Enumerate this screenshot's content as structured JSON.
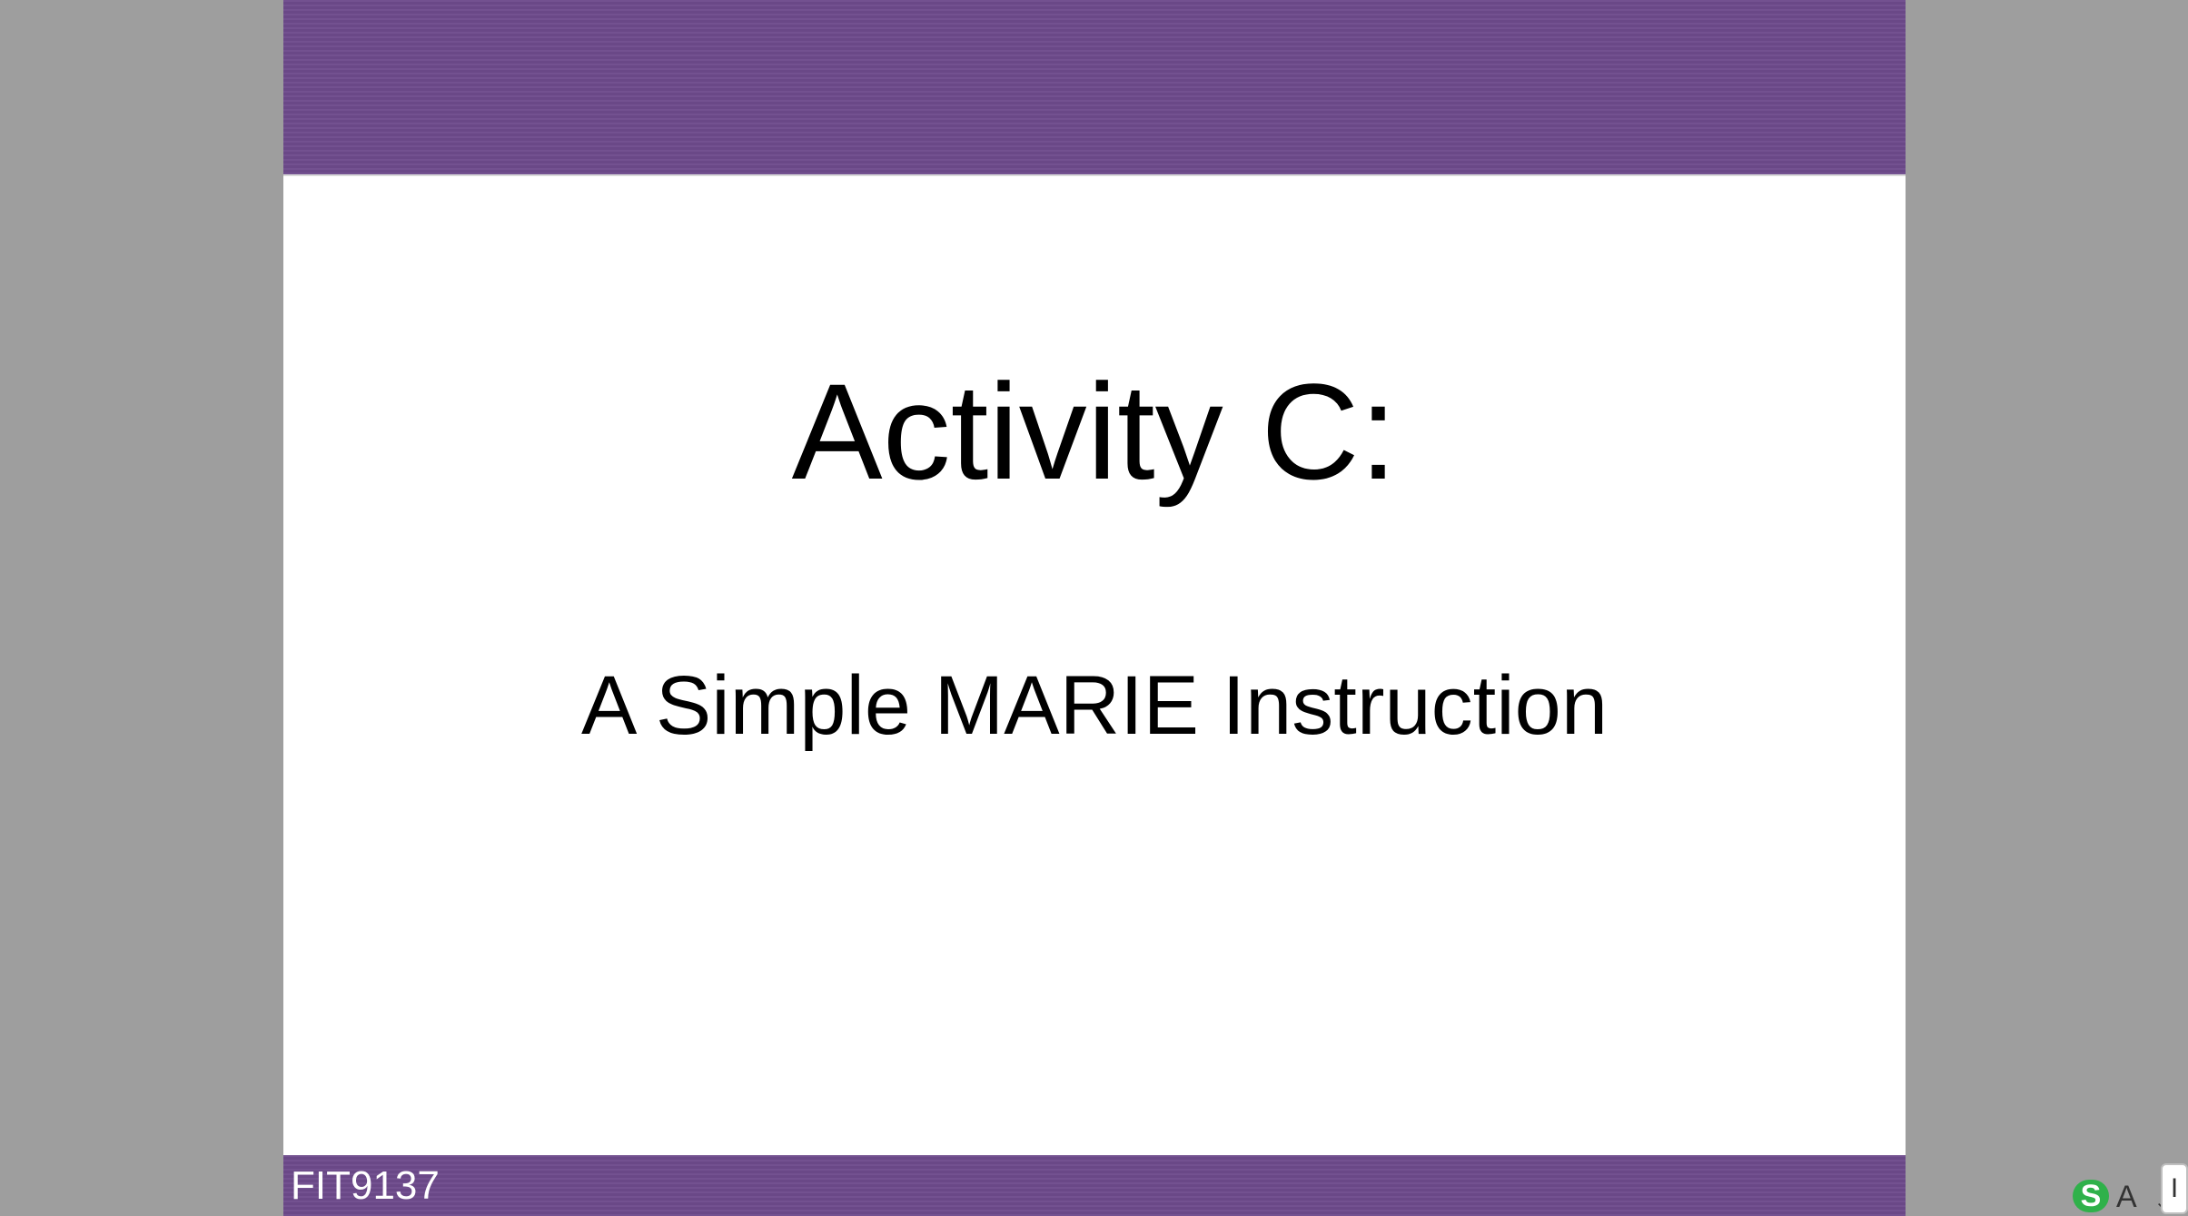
{
  "slide": {
    "title": "Activity C:",
    "subtitle": "A Simple MARIE Instruction",
    "footer_code": "FIT9137"
  },
  "ime": {
    "logo_letter": "S",
    "mode_letter": "A",
    "chevron": "⌄",
    "box_letter": "I"
  },
  "colors": {
    "band": "#6e4b8c",
    "background": "#9e9e9e",
    "slide": "#ffffff",
    "ime_logo": "#2fb14a"
  }
}
